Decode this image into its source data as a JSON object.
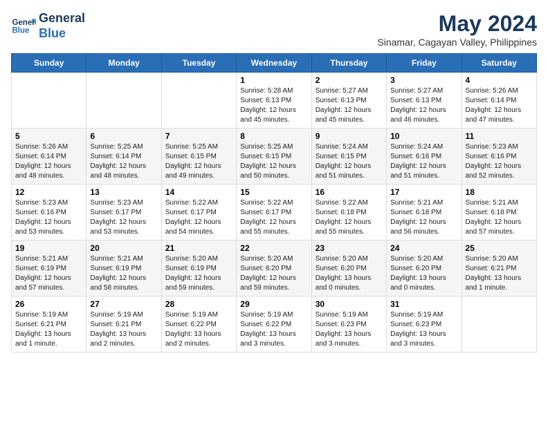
{
  "logo": {
    "line1": "General",
    "line2": "Blue"
  },
  "title": "May 2024",
  "location": "Sinamar, Cagayan Valley, Philippines",
  "weekdays": [
    "Sunday",
    "Monday",
    "Tuesday",
    "Wednesday",
    "Thursday",
    "Friday",
    "Saturday"
  ],
  "weeks": [
    [
      {
        "day": "",
        "info": ""
      },
      {
        "day": "",
        "info": ""
      },
      {
        "day": "",
        "info": ""
      },
      {
        "day": "1",
        "info": "Sunrise: 5:28 AM\nSunset: 6:13 PM\nDaylight: 12 hours\nand 45 minutes."
      },
      {
        "day": "2",
        "info": "Sunrise: 5:27 AM\nSunset: 6:13 PM\nDaylight: 12 hours\nand 45 minutes."
      },
      {
        "day": "3",
        "info": "Sunrise: 5:27 AM\nSunset: 6:13 PM\nDaylight: 12 hours\nand 46 minutes."
      },
      {
        "day": "4",
        "info": "Sunrise: 5:26 AM\nSunset: 6:14 PM\nDaylight: 12 hours\nand 47 minutes."
      }
    ],
    [
      {
        "day": "5",
        "info": "Sunrise: 5:26 AM\nSunset: 6:14 PM\nDaylight: 12 hours\nand 48 minutes."
      },
      {
        "day": "6",
        "info": "Sunrise: 5:25 AM\nSunset: 6:14 PM\nDaylight: 12 hours\nand 48 minutes."
      },
      {
        "day": "7",
        "info": "Sunrise: 5:25 AM\nSunset: 6:15 PM\nDaylight: 12 hours\nand 49 minutes."
      },
      {
        "day": "8",
        "info": "Sunrise: 5:25 AM\nSunset: 6:15 PM\nDaylight: 12 hours\nand 50 minutes."
      },
      {
        "day": "9",
        "info": "Sunrise: 5:24 AM\nSunset: 6:15 PM\nDaylight: 12 hours\nand 51 minutes."
      },
      {
        "day": "10",
        "info": "Sunrise: 5:24 AM\nSunset: 6:16 PM\nDaylight: 12 hours\nand 51 minutes."
      },
      {
        "day": "11",
        "info": "Sunrise: 5:23 AM\nSunset: 6:16 PM\nDaylight: 12 hours\nand 52 minutes."
      }
    ],
    [
      {
        "day": "12",
        "info": "Sunrise: 5:23 AM\nSunset: 6:16 PM\nDaylight: 12 hours\nand 53 minutes."
      },
      {
        "day": "13",
        "info": "Sunrise: 5:23 AM\nSunset: 6:17 PM\nDaylight: 12 hours\nand 53 minutes."
      },
      {
        "day": "14",
        "info": "Sunrise: 5:22 AM\nSunset: 6:17 PM\nDaylight: 12 hours\nand 54 minutes."
      },
      {
        "day": "15",
        "info": "Sunrise: 5:22 AM\nSunset: 6:17 PM\nDaylight: 12 hours\nand 55 minutes."
      },
      {
        "day": "16",
        "info": "Sunrise: 5:22 AM\nSunset: 6:18 PM\nDaylight: 12 hours\nand 55 minutes."
      },
      {
        "day": "17",
        "info": "Sunrise: 5:21 AM\nSunset: 6:18 PM\nDaylight: 12 hours\nand 56 minutes."
      },
      {
        "day": "18",
        "info": "Sunrise: 5:21 AM\nSunset: 6:18 PM\nDaylight: 12 hours\nand 57 minutes."
      }
    ],
    [
      {
        "day": "19",
        "info": "Sunrise: 5:21 AM\nSunset: 6:19 PM\nDaylight: 12 hours\nand 57 minutes."
      },
      {
        "day": "20",
        "info": "Sunrise: 5:21 AM\nSunset: 6:19 PM\nDaylight: 12 hours\nand 58 minutes."
      },
      {
        "day": "21",
        "info": "Sunrise: 5:20 AM\nSunset: 6:19 PM\nDaylight: 12 hours\nand 59 minutes."
      },
      {
        "day": "22",
        "info": "Sunrise: 5:20 AM\nSunset: 6:20 PM\nDaylight: 12 hours\nand 59 minutes."
      },
      {
        "day": "23",
        "info": "Sunrise: 5:20 AM\nSunset: 6:20 PM\nDaylight: 13 hours\nand 0 minutes."
      },
      {
        "day": "24",
        "info": "Sunrise: 5:20 AM\nSunset: 6:20 PM\nDaylight: 13 hours\nand 0 minutes."
      },
      {
        "day": "25",
        "info": "Sunrise: 5:20 AM\nSunset: 6:21 PM\nDaylight: 13 hours\nand 1 minute."
      }
    ],
    [
      {
        "day": "26",
        "info": "Sunrise: 5:19 AM\nSunset: 6:21 PM\nDaylight: 13 hours\nand 1 minute."
      },
      {
        "day": "27",
        "info": "Sunrise: 5:19 AM\nSunset: 6:21 PM\nDaylight: 13 hours\nand 2 minutes."
      },
      {
        "day": "28",
        "info": "Sunrise: 5:19 AM\nSunset: 6:22 PM\nDaylight: 13 hours\nand 2 minutes."
      },
      {
        "day": "29",
        "info": "Sunrise: 5:19 AM\nSunset: 6:22 PM\nDaylight: 13 hours\nand 3 minutes."
      },
      {
        "day": "30",
        "info": "Sunrise: 5:19 AM\nSunset: 6:23 PM\nDaylight: 13 hours\nand 3 minutes."
      },
      {
        "day": "31",
        "info": "Sunrise: 5:19 AM\nSunset: 6:23 PM\nDaylight: 13 hours\nand 3 minutes."
      },
      {
        "day": "",
        "info": ""
      }
    ]
  ]
}
